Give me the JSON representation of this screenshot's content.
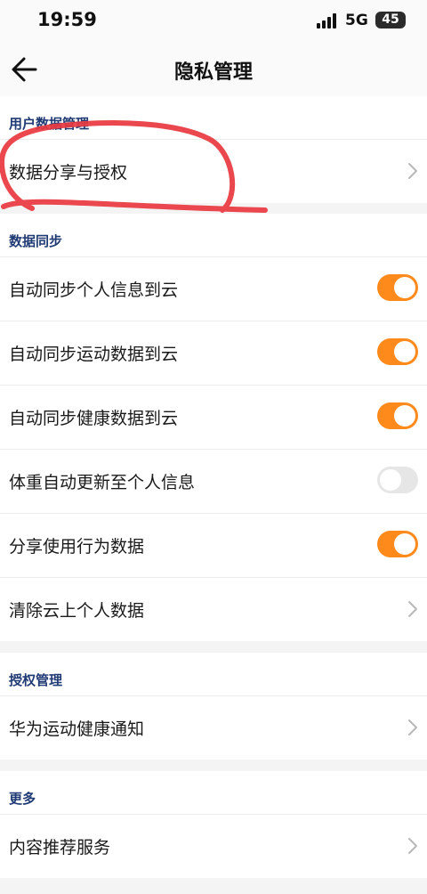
{
  "status_bar": {
    "time": "19:59",
    "network": "5G",
    "battery": "45"
  },
  "nav": {
    "title": "隐私管理",
    "back_icon": "arrow-left-icon"
  },
  "sections": {
    "user_data": {
      "header": "用户数据管理",
      "items": [
        {
          "label": "数据分享与授权",
          "control": "chevron"
        }
      ]
    },
    "sync": {
      "header": "数据同步",
      "items": [
        {
          "label": "自动同步个人信息到云",
          "control": "toggle",
          "on": true
        },
        {
          "label": "自动同步运动数据到云",
          "control": "toggle",
          "on": true
        },
        {
          "label": "自动同步健康数据到云",
          "control": "toggle",
          "on": true
        },
        {
          "label": "体重自动更新至个人信息",
          "control": "toggle",
          "on": false
        },
        {
          "label": "分享使用行为数据",
          "control": "toggle",
          "on": true
        },
        {
          "label": "清除云上个人数据",
          "control": "chevron"
        }
      ]
    },
    "auth": {
      "header": "授权管理",
      "items": [
        {
          "label": "华为运动健康通知",
          "control": "chevron"
        }
      ]
    },
    "more": {
      "header": "更多",
      "items": [
        {
          "label": "内容推荐服务",
          "control": "chevron"
        }
      ]
    }
  },
  "colors": {
    "toggle_on": "#ff8a1c",
    "toggle_off": "#e6e6e6",
    "section_header": "#203a73",
    "annotation": "#e8383f"
  }
}
